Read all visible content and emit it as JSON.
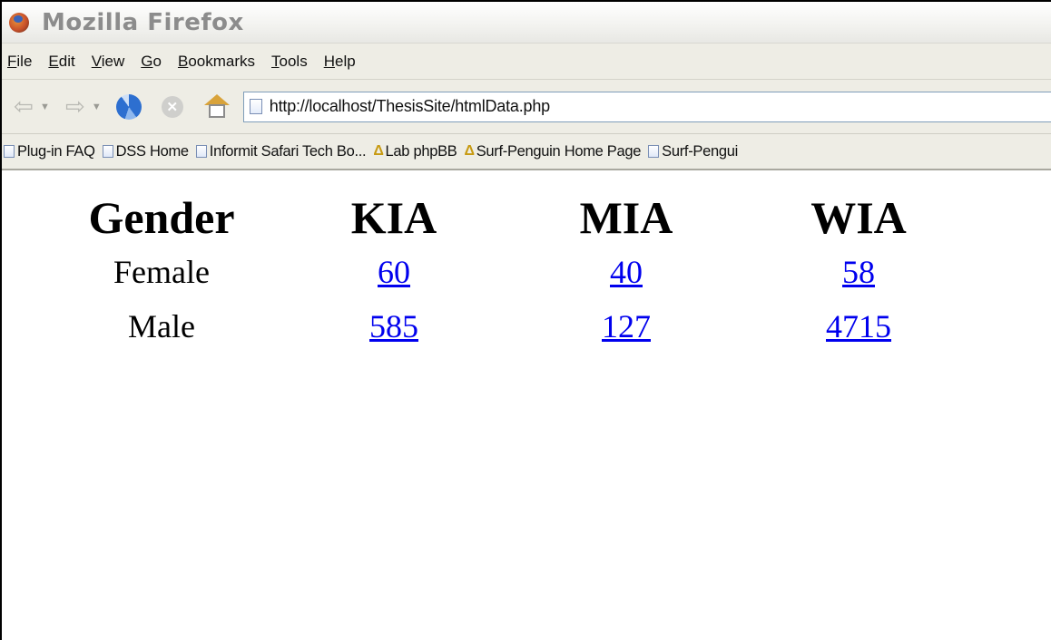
{
  "window": {
    "title": "Mozilla Firefox",
    "app_icon": "firefox-icon"
  },
  "menu": {
    "items": [
      {
        "accel": "F",
        "rest": "ile"
      },
      {
        "accel": "E",
        "rest": "dit"
      },
      {
        "accel": "V",
        "rest": "iew"
      },
      {
        "accel": "G",
        "rest": "o"
      },
      {
        "accel": "B",
        "rest": "ookmarks"
      },
      {
        "accel": "T",
        "rest": "ools"
      },
      {
        "accel": "H",
        "rest": "elp"
      }
    ]
  },
  "navbar": {
    "back_icon": "back-arrow-icon",
    "forward_icon": "forward-arrow-icon",
    "reload_icon": "reload-icon",
    "stop_icon": "stop-icon",
    "home_icon": "home-icon",
    "url": "http://localhost/ThesisSite/htmlData.php"
  },
  "bookmarks": {
    "items": [
      {
        "label": "Plug-in FAQ",
        "icon": "page-icon"
      },
      {
        "label": "DSS Home",
        "icon": "page-icon"
      },
      {
        "label": "Informit Safari Tech Bo...",
        "icon": "page-icon"
      },
      {
        "label": "Lab phpBB",
        "icon": "tux-icon"
      },
      {
        "label": "Surf-Penguin Home Page",
        "icon": "tux-icon"
      },
      {
        "label": "Surf-Pengui",
        "icon": "page-icon"
      }
    ]
  },
  "table": {
    "headers": [
      "Gender",
      "KIA",
      "MIA",
      "WIA"
    ],
    "rows": [
      {
        "label": "Female",
        "values": [
          "60",
          "40",
          "58"
        ]
      },
      {
        "label": "Male",
        "values": [
          "585",
          "127",
          "4715"
        ]
      }
    ]
  },
  "colors": {
    "link": "#0000ee",
    "chrome": "#eeede5",
    "title_text": "#8c8c8c"
  }
}
